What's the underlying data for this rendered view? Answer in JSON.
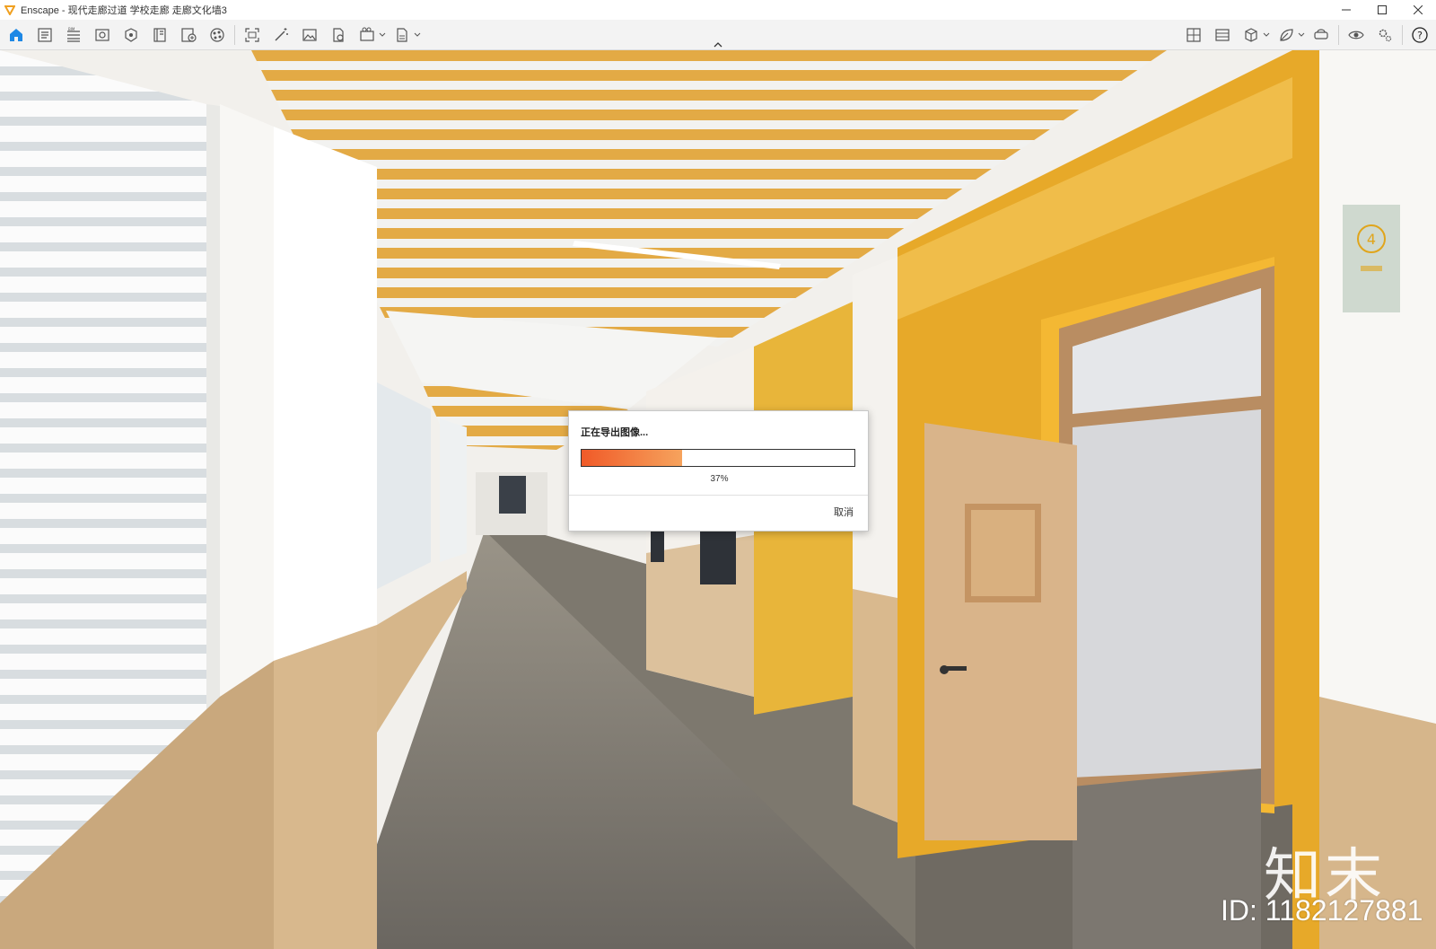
{
  "window": {
    "title": "Enscape - 现代走廊过道 学校走廊 走廊文化墙3",
    "app_logo_color": "#f0a020"
  },
  "toolbar": {
    "left_icons": [
      "home-icon",
      "document-list-icon",
      "bim-icon",
      "view-icon",
      "scene-icon",
      "book-icon",
      "batch-render-icon",
      "materials-icon",
      "screenshot-icon",
      "magic-wand-icon",
      "image-icon",
      "export-file-icon",
      "video-icon",
      "export-icon"
    ],
    "right_icons": [
      "asset-library-icon",
      "image-gallery-icon",
      "cube-icon",
      "leaf-icon",
      "vr-headset-icon",
      "visibility-icon",
      "settings-icon",
      "help-icon"
    ],
    "accent": "#1e88e5"
  },
  "dialog": {
    "title": "正在导出图像...",
    "progress": 0.37,
    "progress_label": "37%",
    "cancel_label": "取消"
  },
  "watermark": {
    "logo_text": "知末",
    "id_text": "ID: 1182127881"
  }
}
